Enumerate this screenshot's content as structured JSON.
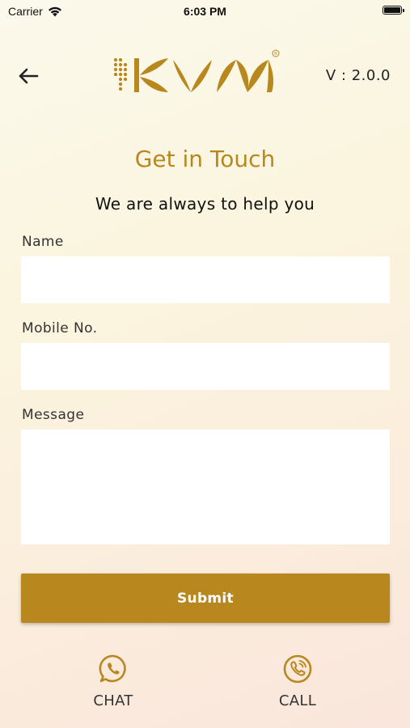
{
  "status_bar": {
    "carrier": "Carrier",
    "time": "6:03 PM"
  },
  "header": {
    "logo_text": "KVM",
    "version": "V : 2.0.0"
  },
  "page": {
    "title": "Get in Touch",
    "subtitle": "We are always to help you"
  },
  "form": {
    "name_label": "Name",
    "name_value": "",
    "mobile_label": "Mobile No.",
    "mobile_value": "",
    "message_label": "Message",
    "message_value": "",
    "submit_label": "Submit"
  },
  "actions": {
    "chat_label": "CHAT",
    "call_label": "CALL"
  },
  "colors": {
    "accent": "#b8881e",
    "background": "#fbf5df",
    "field": "#ffffff"
  }
}
